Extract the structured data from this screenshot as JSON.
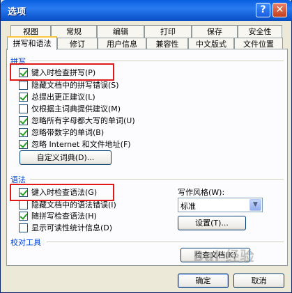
{
  "window": {
    "title": "选项",
    "help_glyph": "?",
    "close_glyph": "✕"
  },
  "tabs": {
    "row1": [
      "视图",
      "常规",
      "编辑",
      "打印",
      "保存",
      "安全性"
    ],
    "row2": [
      "拼写和语法",
      "修订",
      "用户信息",
      "兼容性",
      "中文版式",
      "文件位置"
    ],
    "active": "拼写和语法"
  },
  "spelling": {
    "section_title": "拼写",
    "options": [
      {
        "label": "键入时检查拼写(P)",
        "checked": true
      },
      {
        "label": "隐藏文档中的拼写错误(S)",
        "checked": false
      },
      {
        "label": "总提出更正建议(L)",
        "checked": true
      },
      {
        "label": "仅根据主词典提供建议(M)",
        "checked": false
      },
      {
        "label": "忽略所有字母都大写的单词(U)",
        "checked": true
      },
      {
        "label": "忽略带数字的单词(B)",
        "checked": true
      },
      {
        "label": "忽略 Internet 和文件地址(F)",
        "checked": true
      }
    ],
    "custom_dict_button": "自定义词典(D)..."
  },
  "grammar": {
    "section_title": "语法",
    "options": [
      {
        "label": "键入时检查语法(G)",
        "checked": true
      },
      {
        "label": "隐藏文档中的语法错误(I)",
        "checked": false
      },
      {
        "label": "随拼写检查语法(H)",
        "checked": true
      },
      {
        "label": "显示可读性统计信息(D)",
        "checked": false
      }
    ],
    "writing_style_label": "写作风格(W):",
    "writing_style_value": "标准",
    "settings_button": "设置(T)..."
  },
  "proofing": {
    "section_title": "校对工具",
    "recheck_button": "检查文档(K)"
  },
  "footer": {
    "ok": "确定",
    "cancel": "取消"
  },
  "watermark_text": "Bai 经验"
}
